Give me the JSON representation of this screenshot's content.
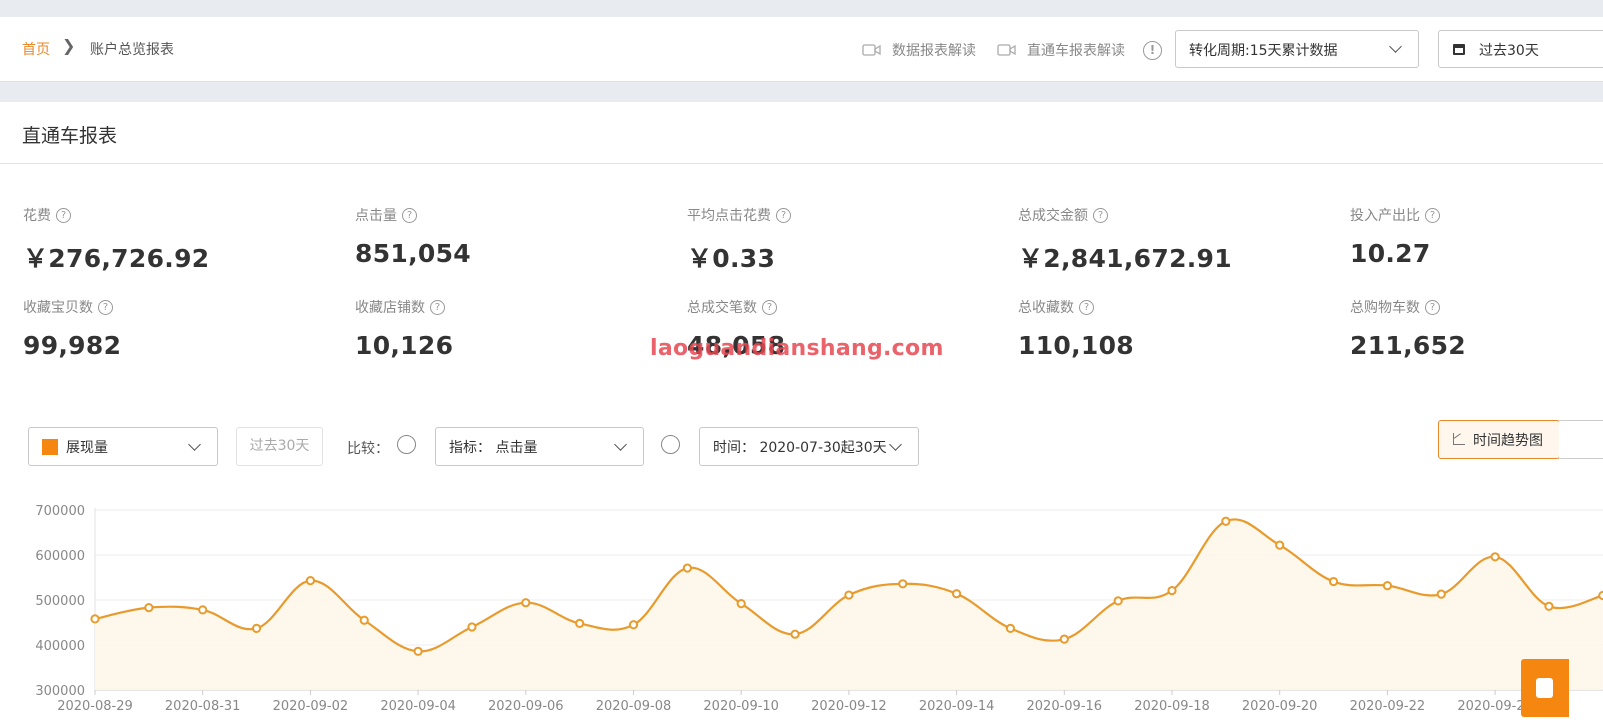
{
  "breadcrumb": {
    "home": "首页",
    "current": "账户总览报表"
  },
  "header": {
    "link1": "数据报表解读",
    "link2": "直通车报表解读",
    "cycle_select": "转化周期:15天累计数据",
    "date_select": "过去30天"
  },
  "panel": {
    "title": "直通车报表"
  },
  "metrics": [
    {
      "label": "花费",
      "value": "￥276,726.92"
    },
    {
      "label": "点击量",
      "value": "851,054"
    },
    {
      "label": "平均点击花费",
      "value": "￥0.33"
    },
    {
      "label": "总成交金额",
      "value": "￥2,841,672.91"
    },
    {
      "label": "投入产出比",
      "value": "10.27"
    },
    {
      "label": "收藏宝贝数",
      "value": "99,982"
    },
    {
      "label": "收藏店铺数",
      "value": "10,126"
    },
    {
      "label": "总成交笔数",
      "value": "48,058"
    },
    {
      "label": "总收藏数",
      "value": "110,108"
    },
    {
      "label": "总购物车数",
      "value": "211,652"
    }
  ],
  "watermark": "laoguandianshang.com",
  "controls": {
    "metric_select": "展现量",
    "past_button": "过去30天",
    "compare_label": "比较：",
    "indicator_select": "指标： 点击量",
    "time_select": "时间： 2020-07-30起30天",
    "trend_button": "时间趋势图"
  },
  "colors": {
    "accent": "#e7892b",
    "line": "#e89b2c",
    "metric_swatch": "#f5860f"
  },
  "chart_data": {
    "type": "area",
    "y_ticks": [
      "700000",
      "600000",
      "500000",
      "400000",
      "300000"
    ],
    "ylim": [
      300000,
      700000
    ],
    "x_tick_labels": [
      "2020-08-29",
      "2020-08-31",
      "2020-09-02",
      "2020-09-04",
      "2020-09-06",
      "2020-09-08",
      "2020-09-10",
      "2020-09-12",
      "2020-09-14",
      "2020-09-16",
      "2020-09-18",
      "2020-09-20",
      "2020-09-22",
      "2020-09-24"
    ],
    "x": [
      "2020-08-29",
      "2020-08-30",
      "2020-08-31",
      "2020-09-01",
      "2020-09-02",
      "2020-09-03",
      "2020-09-04",
      "2020-09-05",
      "2020-09-06",
      "2020-09-07",
      "2020-09-08",
      "2020-09-09",
      "2020-09-10",
      "2020-09-11",
      "2020-09-12",
      "2020-09-13",
      "2020-09-14",
      "2020-09-15",
      "2020-09-16",
      "2020-09-17",
      "2020-09-18",
      "2020-09-19",
      "2020-09-20",
      "2020-09-21",
      "2020-09-22",
      "2020-09-23",
      "2020-09-24",
      "2020-09-25",
      "2020-09-26"
    ],
    "series": [
      {
        "name": "展现量",
        "values": [
          458000,
          483000,
          478000,
          437000,
          543000,
          455000,
          386000,
          440000,
          494000,
          448000,
          445000,
          571000,
          492000,
          424000,
          511000,
          536000,
          514000,
          437000,
          413000,
          498000,
          521000,
          675000,
          622000,
          541000,
          532000,
          513000,
          596000,
          486000,
          510000
        ]
      }
    ],
    "grid": true
  }
}
